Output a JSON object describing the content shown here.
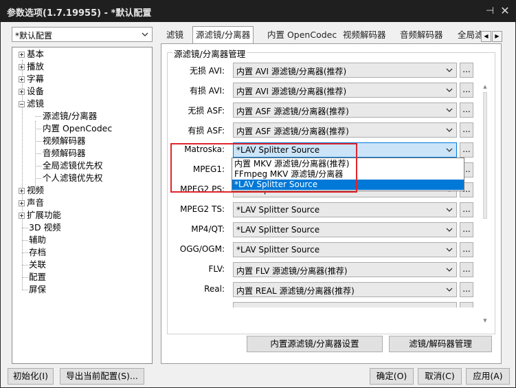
{
  "window": {
    "title": "参数选项(1.7.19955) - *默认配置",
    "pin_glyph": "⊣",
    "close_glyph": "✕"
  },
  "profile": {
    "value": "*默认配置"
  },
  "tree": {
    "items": [
      {
        "label": "基本",
        "expander": "plus"
      },
      {
        "label": "播放",
        "expander": "plus"
      },
      {
        "label": "字幕",
        "expander": "plus"
      },
      {
        "label": "设备",
        "expander": "plus"
      },
      {
        "label": "滤镜",
        "expander": "minus"
      },
      {
        "label": "源滤镜/分离器",
        "child": true
      },
      {
        "label": "内置 OpenCodec",
        "child": true
      },
      {
        "label": "视频解码器",
        "child": true
      },
      {
        "label": "音频解码器",
        "child": true
      },
      {
        "label": "全局滤镜优先权",
        "child": true
      },
      {
        "label": "个人滤镜优先权",
        "child": true
      },
      {
        "label": "视频",
        "expander": "plus"
      },
      {
        "label": "声音",
        "expander": "plus"
      },
      {
        "label": "扩展功能",
        "expander": "plus"
      },
      {
        "label": "3D 视频"
      },
      {
        "label": "辅助"
      },
      {
        "label": "存档"
      },
      {
        "label": "关联"
      },
      {
        "label": "配置"
      },
      {
        "label": "屏保"
      }
    ]
  },
  "tabs": [
    {
      "label": "滤镜"
    },
    {
      "label": "源滤镜/分离器",
      "active": true
    },
    {
      "label": "内置 OpenCodec"
    },
    {
      "label": "视频解码器"
    },
    {
      "label": "音频解码器"
    },
    {
      "label": "全局滤"
    }
  ],
  "tab_scroll": {
    "left": "◀",
    "right": "▶"
  },
  "panel": {
    "group_title": "源滤镜/分离器管理",
    "rows": [
      {
        "label": "无损 AVI:",
        "value": "内置 AVI 源滤镜/分离器(推荐)"
      },
      {
        "label": "有损 AVI:",
        "value": "内置 AVI 源滤镜/分离器(推荐)"
      },
      {
        "label": "无损 ASF:",
        "value": "内置 ASF 源滤镜/分离器(推荐)"
      },
      {
        "label": "有损 ASF:",
        "value": "内置 ASF 源滤镜/分离器(推荐)"
      },
      {
        "label": "Matroska:",
        "value": "*LAV Splitter Source"
      },
      {
        "label": "MPEG1:",
        "value": ""
      },
      {
        "label": "MPEG2 PS:",
        "value": "*LAV Splitter Source"
      },
      {
        "label": "MPEG2 TS:",
        "value": "*LAV Splitter Source"
      },
      {
        "label": "MP4/QT:",
        "value": "*LAV Splitter Source"
      },
      {
        "label": "OGG/OGM:",
        "value": "*LAV Splitter Source"
      },
      {
        "label": "FLV:",
        "value": "内置 FLV 源滤镜/分离器(推荐)"
      },
      {
        "label": "Real:",
        "value": "内置 REAL 源滤镜/分离器(推荐)"
      }
    ],
    "dots_label": "...",
    "dropdown_options": [
      {
        "label": "内置 MKV 源滤镜/分离器(推荐)"
      },
      {
        "label": "FFmpeg MKV 源滤镜/分离器"
      },
      {
        "label": "*LAV Splitter Source",
        "selected": true
      }
    ],
    "builtin_settings_button": "内置源滤镜/分离器设置",
    "filter_manager_button": "滤镜/解码器管理"
  },
  "footer": {
    "init_button": "初始化(I)",
    "export_button": "导出当前配置(S)...",
    "ok_button": "确定(O)",
    "cancel_button": "取消(C)",
    "apply_button": "应用(A)"
  },
  "colors": {
    "titlebar": "#1f1f1f",
    "highlight_red": "#e0252b",
    "selection_blue": "#0078d7"
  }
}
